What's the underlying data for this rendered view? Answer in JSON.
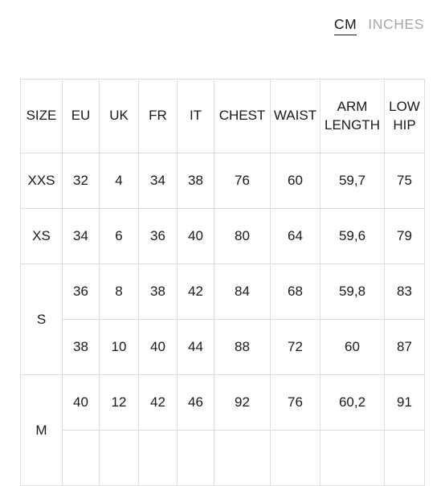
{
  "unit_toggle": {
    "options": [
      {
        "label": "CM",
        "state": "active"
      },
      {
        "label": "INCHES",
        "state": "inactive"
      }
    ],
    "active_color": "#1a1a1a",
    "inactive_color": "#a8a8a8"
  },
  "size_table": {
    "columns": [
      "SIZE",
      "EU",
      "UK",
      "FR",
      "IT",
      "CHEST",
      "WAIST",
      "ARM LENGTH",
      "LOW HIP"
    ],
    "arm_length_line1": "ARM",
    "arm_length_line2": "LENGTH",
    "low_hip_line1": "LOW",
    "low_hip_line2": "HIP",
    "rows": [
      {
        "size": "XXS",
        "eu": "32",
        "uk": "4",
        "fr": "34",
        "it": "38",
        "chest": "76",
        "waist": "60",
        "arm_length": "59,7",
        "low_hip": "75"
      },
      {
        "size": "XS",
        "eu": "34",
        "uk": "6",
        "fr": "36",
        "it": "40",
        "chest": "80",
        "waist": "64",
        "arm_length": "59,6",
        "low_hip": "79"
      },
      {
        "size": "S",
        "eu": "36",
        "uk": "8",
        "fr": "38",
        "it": "42",
        "chest": "84",
        "waist": "68",
        "arm_length": "59,8",
        "low_hip": "83"
      },
      {
        "size": "S",
        "eu": "38",
        "uk": "10",
        "fr": "40",
        "it": "44",
        "chest": "88",
        "waist": "72",
        "arm_length": "60",
        "low_hip": "87"
      },
      {
        "size": "M",
        "eu": "40",
        "uk": "12",
        "fr": "42",
        "it": "46",
        "chest": "92",
        "waist": "76",
        "arm_length": "60,2",
        "low_hip": "91"
      },
      {
        "size": "M",
        "eu": "",
        "uk": "",
        "fr": "",
        "it": "",
        "chest": "",
        "waist": "",
        "arm_length": "",
        "low_hip": ""
      }
    ],
    "border_color": "#dedede",
    "text_color": "#1a1a1a"
  }
}
